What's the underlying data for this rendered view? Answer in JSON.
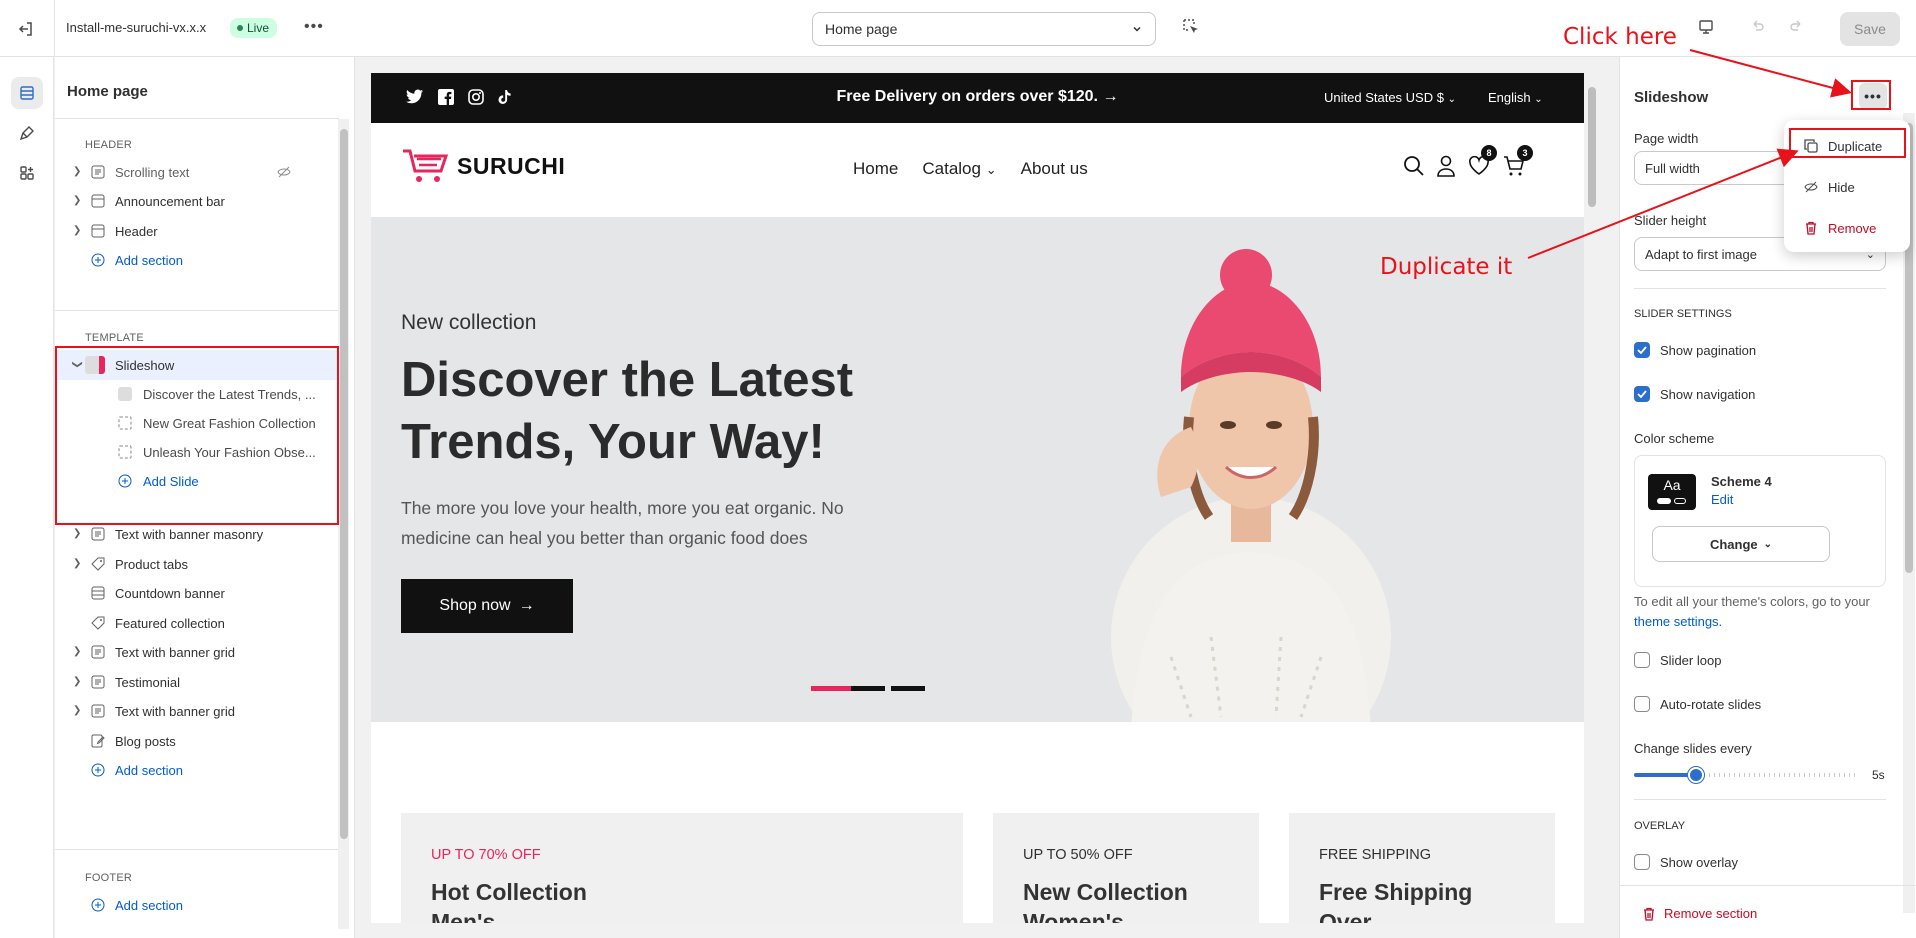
{
  "topbar": {
    "theme_name": "Install-me-suruchi-vx.x.x",
    "live_label": "Live",
    "page_selector": "Home page",
    "save_label": "Save"
  },
  "left_panel": {
    "title": "Home page",
    "header_group": "HEADER",
    "header_items": [
      "Scrolling text",
      "Announcement bar",
      "Header"
    ],
    "add_section": "Add section",
    "template_group": "TEMPLATE",
    "slideshow_label": "Slideshow",
    "slides": [
      "Discover the Latest Trends, ...",
      "New Great Fashion Collection",
      "Unleash Your Fashion Obse..."
    ],
    "add_slide": "Add Slide",
    "template_items": [
      "Text with banner masonry",
      "Product tabs",
      "Countdown banner",
      "Featured collection",
      "Text with banner grid",
      "Testimonial",
      "Text with banner grid",
      "Blog posts"
    ],
    "footer_group": "FOOTER"
  },
  "preview": {
    "announcement": "Free Delivery on orders over $120.",
    "currency": "United States USD $",
    "language": "English",
    "logo": "SURUCHI",
    "nav": [
      "Home",
      "Catalog",
      "About us"
    ],
    "wishlist_count": "8",
    "cart_count": "3",
    "hero": {
      "subheading": "New collection",
      "heading": "Discover the Latest Trends, Your Way!",
      "text": "The more you love your health, more you eat organic. No medicine can heal you better than organic food does",
      "button": "Shop now"
    },
    "banners": [
      {
        "tag": "UP TO 70% OFF",
        "title": "Hot Collection Men's",
        "tag_color": "#e8265e"
      },
      {
        "tag": "UP TO 50% OFF",
        "title": "New Collection Women's",
        "tag_color": "#333333"
      },
      {
        "tag": "FREE SHIPPING",
        "title": "Free Shipping Over",
        "tag_color": "#333333"
      }
    ]
  },
  "right_panel": {
    "title": "Slideshow",
    "page_width_label": "Page width",
    "page_width_value": "Full width",
    "slider_height_label": "Slider height",
    "slider_height_value": "Adapt to first image",
    "slider_settings": "SLIDER SETTINGS",
    "show_pagination": "Show pagination",
    "show_navigation": "Show navigation",
    "color_scheme_label": "Color scheme",
    "scheme_swatch": "Aa",
    "scheme_name": "Scheme 4",
    "scheme_edit": "Edit",
    "change_btn": "Change",
    "help_text": "To edit all your theme's colors, go to your",
    "help_link": "theme settings.",
    "slider_loop": "Slider loop",
    "auto_rotate": "Auto-rotate slides",
    "change_slides_label": "Change slides every",
    "change_slides_value": "5s",
    "change_slides_fraction": 0.28,
    "overlay_heading": "OVERLAY",
    "show_overlay": "Show overlay",
    "remove_section": "Remove section"
  },
  "menu": {
    "duplicate": "Duplicate",
    "hide": "Hide",
    "remove": "Remove"
  },
  "annotations": {
    "click_here": "Click here",
    "duplicate_it": "Duplicate it",
    "color": "#e8121b"
  }
}
